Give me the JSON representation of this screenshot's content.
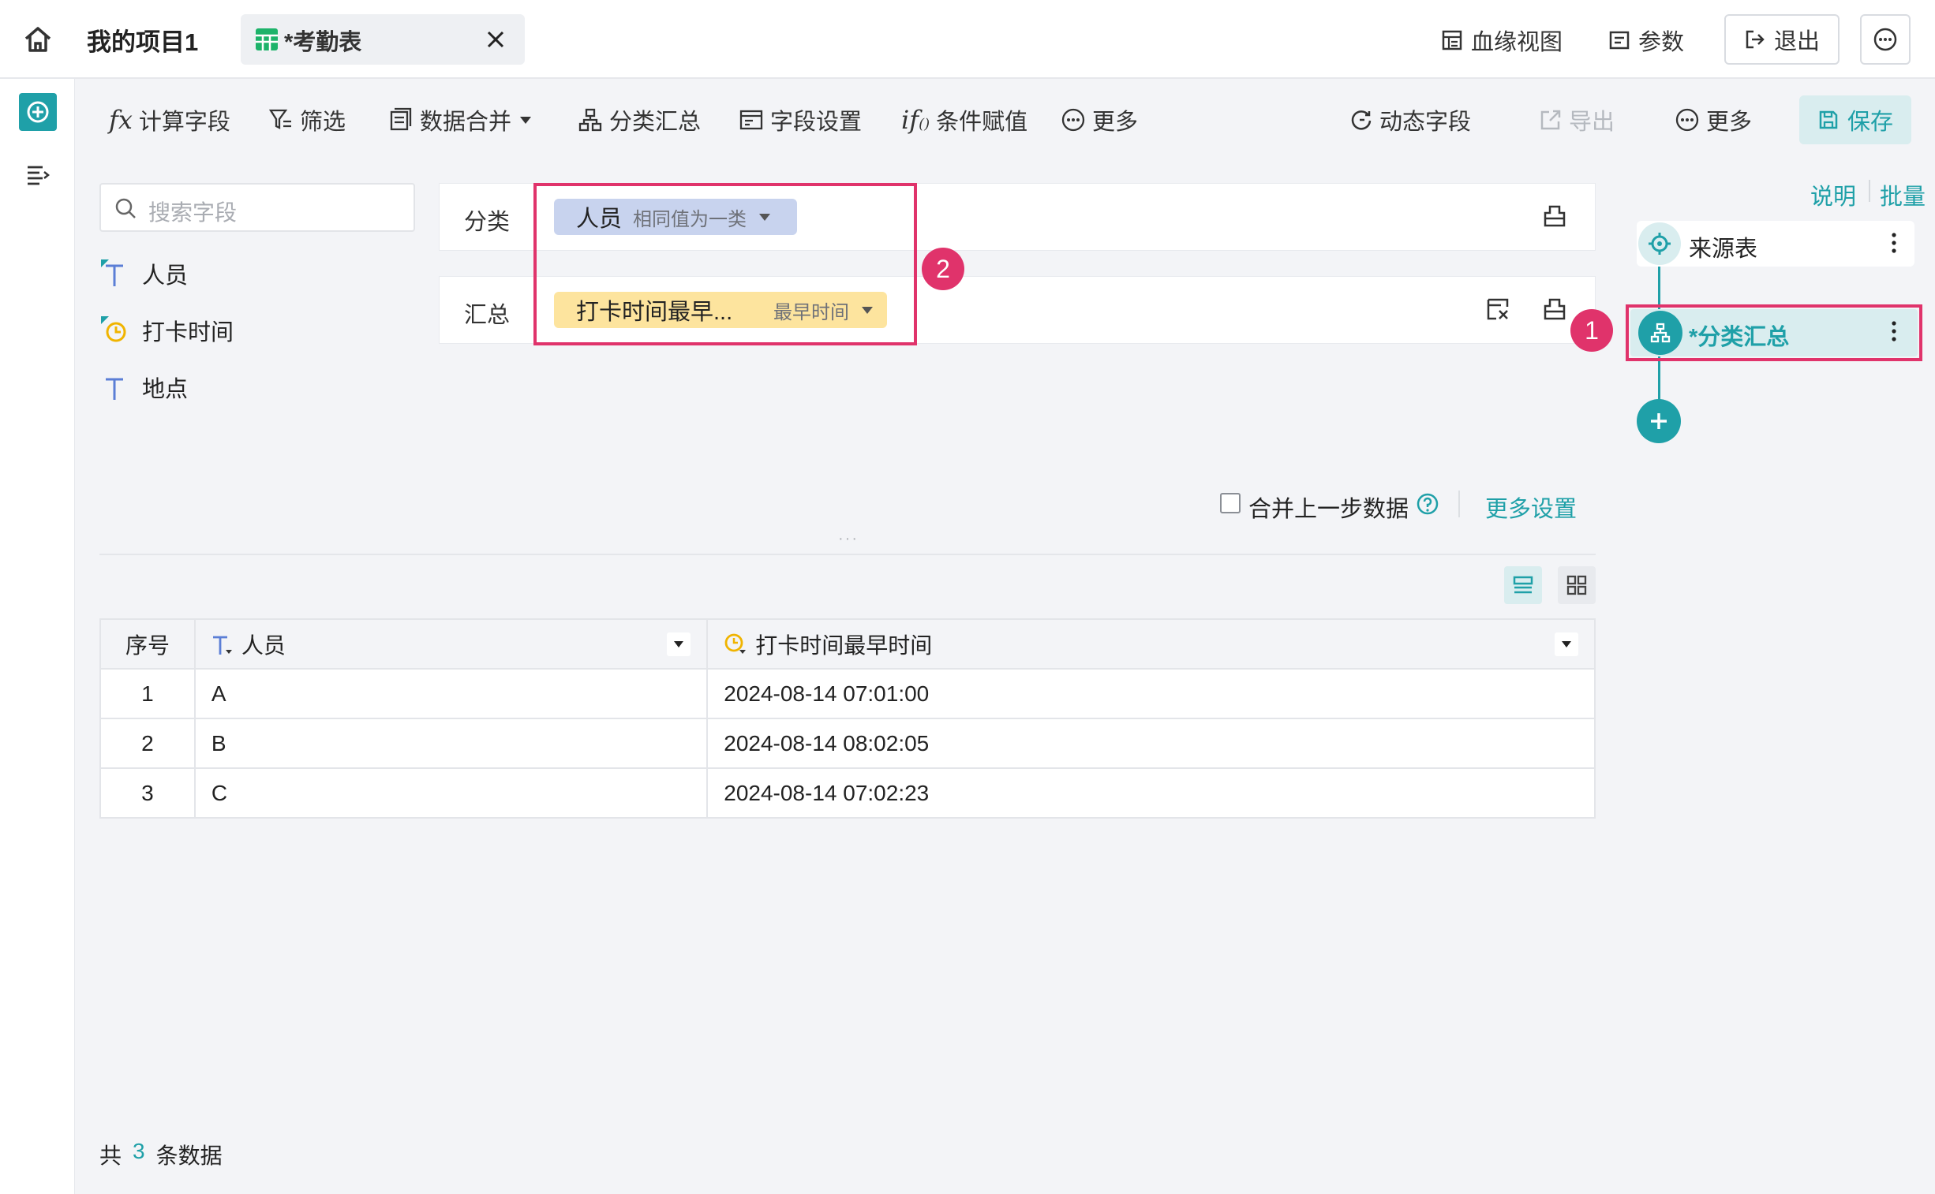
{
  "topbar": {
    "project_title": "我的项目1",
    "tab_label": "*考勤表",
    "lineage_label": "血缘视图",
    "params_label": "参数",
    "exit_label": "退出"
  },
  "toolbar": {
    "calc_field": "计算字段",
    "filter": "筛选",
    "merge": "数据合并",
    "group_sum": "分类汇总",
    "field_settings": "字段设置",
    "cond_assign": "条件赋值",
    "more1": "更多",
    "dynamic_field": "动态字段",
    "export": "导出",
    "more2": "更多",
    "save": "保存"
  },
  "fields": {
    "search_placeholder": "搜索字段",
    "items": [
      {
        "label": "人员",
        "icon": "text-type-icon"
      },
      {
        "label": "打卡时间",
        "icon": "time-type-icon"
      },
      {
        "label": "地点",
        "icon": "text-type-icon"
      }
    ]
  },
  "config": {
    "group_label": "分类",
    "group_chip": {
      "main": "人员",
      "sub": "相同值为一类"
    },
    "sum_label": "汇总",
    "sum_chip": {
      "main": "打卡时间最早...",
      "sub": "最早时间"
    },
    "merge_prev_label": "合并上一步数据",
    "more_settings": "更多设置",
    "badge2": "2"
  },
  "table": {
    "headers": [
      "序号",
      "人员",
      "打卡时间最早时间"
    ],
    "rows": [
      [
        "1",
        "A",
        "2024-08-14 07:01:00"
      ],
      [
        "2",
        "B",
        "2024-08-14 08:02:05"
      ],
      [
        "3",
        "C",
        "2024-08-14 07:02:23"
      ]
    ],
    "footer_prefix": "共",
    "footer_count": "3",
    "footer_suffix": "条数据"
  },
  "rightpanel": {
    "explain": "说明",
    "batch": "批量",
    "source_node": "来源表",
    "group_node": "*分类汇总",
    "badge1": "1"
  },
  "colors": {
    "accent": "#1fa0a8",
    "highlight": "#e0336b",
    "group_chip": "#c8d3ee",
    "sum_chip": "#fde49e"
  }
}
